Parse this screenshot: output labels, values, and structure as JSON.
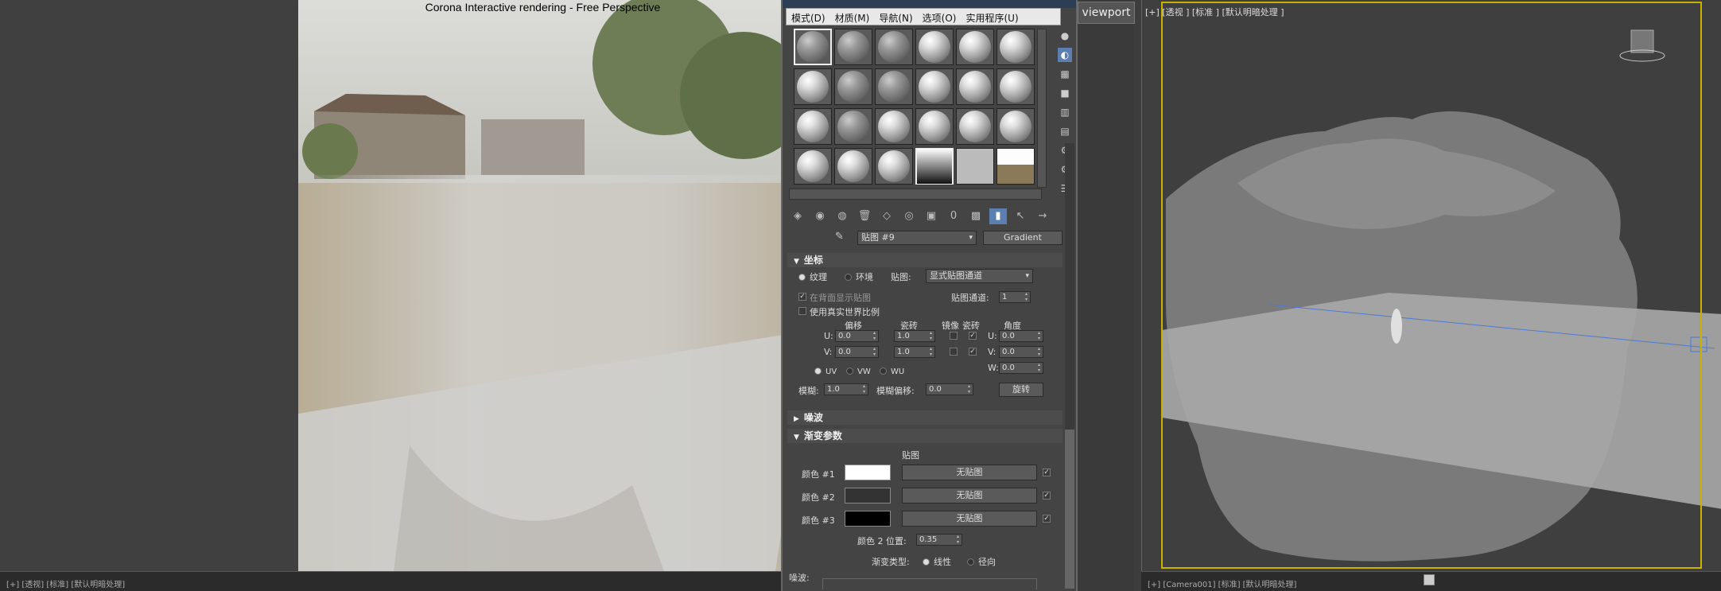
{
  "render_window": {
    "title": "Corona Interactive rendering - Free Perspective"
  },
  "left_status": {
    "text": "[+] [透视] [标准] [默认明暗处理]"
  },
  "viewport_button": {
    "label": "viewport"
  },
  "right_viewport": {
    "label": "[+] [透视 ] [标准 ] [默认明暗处理 ]",
    "status": "[+] [Camera001] [标准] [默认明暗处理]"
  },
  "material_editor": {
    "menu": [
      "模式(D)",
      "材质(M)",
      "导航(N)",
      "选项(O)",
      "实用程序(U)"
    ],
    "map_name": "贴图 #9",
    "map_type": "Gradient",
    "rollouts": {
      "coordinates": "坐标",
      "noise": "噪波",
      "gradient_params": "渐变参数"
    },
    "coords": {
      "texture": "纹理",
      "environment": "环境",
      "mapping_label": "贴图:",
      "mapping_value": "显式贴图通道",
      "show_on_back": "在背面显示贴图",
      "map_channel_label": "贴图通道:",
      "map_channel_value": "1",
      "real_world": "使用真实世界比例",
      "col_offset": "偏移",
      "col_tiling": "瓷砖",
      "col_mirror": "镜像",
      "col_tile": "瓷砖",
      "col_angle": "角度",
      "u": "U:",
      "v": "V:",
      "w": "W:",
      "u_offset": "0.0",
      "v_offset": "0.0",
      "u_tiling": "1.0",
      "v_tiling": "1.0",
      "u_angle": "0.0",
      "v_angle": "0.0",
      "w_angle": "0.0",
      "uv": "UV",
      "vw": "VW",
      "wu": "WU",
      "blur_label": "模糊:",
      "blur_value": "1.0",
      "blur_offset_label": "模糊偏移:",
      "blur_offset_value": "0.0",
      "rotate": "旋转"
    },
    "gradient": {
      "map_header": "贴图",
      "color1": "颜色 #1",
      "color2": "颜色 #2",
      "color3": "颜色 #3",
      "no_map": "无贴图",
      "color1_hex": "#ffffff",
      "color2_hex": "#333333",
      "color3_hex": "#000000",
      "pos_label": "颜色 2 位置:",
      "pos_value": "0.35",
      "type_label": "渐变类型:",
      "linear": "线性",
      "radial": "径向",
      "noise_label": "噪波:"
    }
  }
}
